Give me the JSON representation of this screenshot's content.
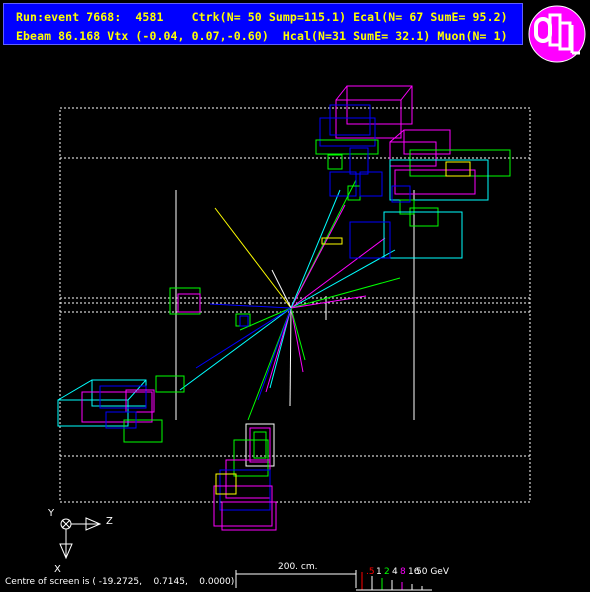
{
  "header": {
    "line1": "Run:event 7668:  4581    Ctrk(N= 50 Sump=115.1) Ecal(N= 67 SumE= 95.2)",
    "line2": "Ebeam 86.168 Vtx (-0.04, 0.07,-0.60)  Hcal(N=31 SumE= 32.1) Muon(N= 1)"
  },
  "logo": {
    "text": "OPAL"
  },
  "axes": {
    "y": "Y",
    "z": "Z",
    "x": "X"
  },
  "scale": {
    "label": "200. cm."
  },
  "energy_scale": {
    "labels": [
      ".5",
      "1",
      "2",
      "4",
      "8",
      "16",
      "50 GeV"
    ],
    "colors": [
      "#ff0000",
      "#ffffff",
      "#00ff00",
      "#ffffff",
      "#ff00ff",
      "#ffffff",
      "#ffffff"
    ]
  },
  "footer": {
    "centre": "Centre of screen is ( -19.2725,    0.7145,    0.0000)"
  },
  "colors": {
    "header_bg": "#0000ff",
    "header_text": "#ffff00",
    "logo_bg": "#ff00ff",
    "cyan": "#00ffff",
    "magenta": "#ff00ff",
    "green": "#00ff00",
    "blue": "#0000ff",
    "yellow": "#ffff00"
  }
}
